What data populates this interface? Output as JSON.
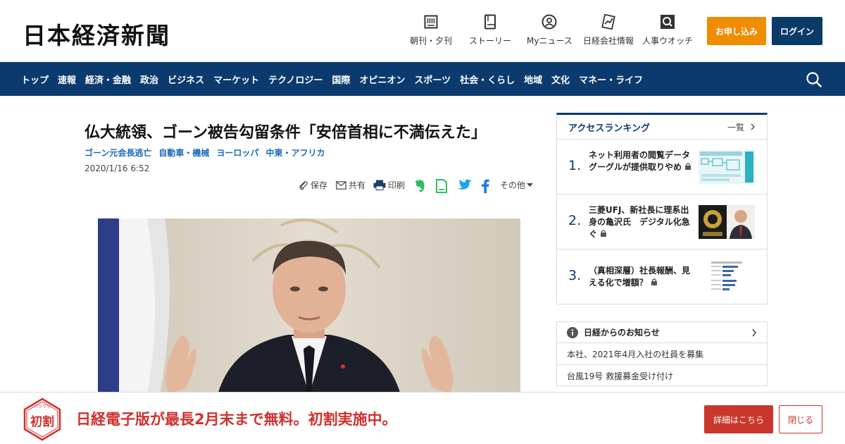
{
  "header": {
    "logo": "日本経済新聞",
    "nav": [
      {
        "label": "朝刊・夕刊",
        "icon": "newspaper-icon"
      },
      {
        "label": "ストーリー",
        "icon": "book-icon"
      },
      {
        "label": "Myニュース",
        "icon": "user-icon"
      },
      {
        "label": "日経会社情報",
        "icon": "chart-icon"
      },
      {
        "label": "人事ウオッチ",
        "icon": "search-icon"
      }
    ],
    "apply_label": "お申し込み",
    "login_label": "ログイン"
  },
  "navbar": {
    "items": [
      "トップ",
      "速報",
      "経済・金融",
      "政治",
      "ビジネス",
      "マーケット",
      "テクノロジー",
      "国際",
      "オピニオン",
      "スポーツ",
      "社会・くらし",
      "地域",
      "文化",
      "マネー・ライフ"
    ]
  },
  "article": {
    "title": "仏大統領、ゴーン被告勾留条件「安倍首相に不満伝えた」",
    "tags": [
      "ゴーン元会長逃亡",
      "自動車・機械",
      "ヨーロッパ",
      "中東・アフリカ"
    ],
    "date": "2020/1/16 6:52",
    "toolbar": {
      "save": "保存",
      "share": "共有",
      "print": "印刷",
      "other": "その他"
    }
  },
  "ranking": {
    "title": "アクセスランキング",
    "more": "一覧",
    "items": [
      {
        "rank": "1.",
        "text": "ネット利用者の閲覧データ　グーグルが提供取りやめ"
      },
      {
        "rank": "2.",
        "text": "三菱UFJ、新社長に理系出身の亀沢氏　デジタル化急ぐ"
      },
      {
        "rank": "3.",
        "text": "（真相深層）社長報酬、見える化で増額？"
      }
    ]
  },
  "notice": {
    "title": "日経からのお知らせ",
    "items": [
      "本社、2021年4月入社の社員を募集",
      "台風19号 救援募金受け付け"
    ]
  },
  "banner": {
    "badge_top": "ハツワリ",
    "badge": "初割",
    "text": "日経電子版が最長2月末まで無料。初割実施中。",
    "detail_label": "詳細はこちら",
    "close_label": "閉じる"
  },
  "colors": {
    "navy": "#0b3a6e",
    "orange": "#f08c00",
    "red": "#c9372c"
  }
}
